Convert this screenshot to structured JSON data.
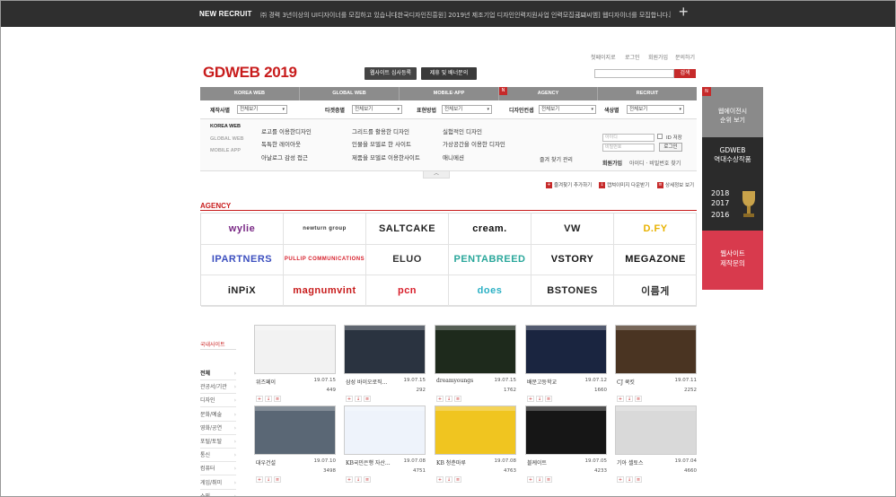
{
  "topbar": {
    "title": "NEW RECRUIT",
    "ticker": [
      "㈜ 경력 3년이상의 UI디자이너를 모집하고 있습니다.",
      "[한국디자인진흥원] 2019년 제조기업 디자인인력지원사업 인력모집공고",
      "[디씨엠] 웹디자이너를 모집합니다."
    ],
    "sep": "|"
  },
  "utility": [
    "첫페이지로",
    "로그인",
    "회원가입",
    "문의하기"
  ],
  "logo": "GDWEB 2019",
  "header_buttons": [
    "웹사이트 심사등록",
    "제휴 및 배너문의"
  ],
  "search": {
    "button": "검색"
  },
  "nav": {
    "mark": "N",
    "items": [
      "KOREA WEB",
      "GLOBAL WEB",
      "MOBILE·APP",
      "AGENCY",
      "RECRUIT"
    ]
  },
  "filters": [
    {
      "label": "제작사별",
      "value": "전체보기"
    },
    {
      "label": "타겟층별",
      "value": "전체보기"
    },
    {
      "label": "표현방법",
      "value": "전체보기"
    },
    {
      "label": "디자인컨셉",
      "value": "전체보기"
    },
    {
      "label": "색상별",
      "value": "전체보기"
    }
  ],
  "panel": {
    "tabs": [
      "KOREA WEB",
      "GLOBAL WEB",
      "MOBILE APP"
    ],
    "col1": [
      "로고를 이용한디자인",
      "독특한 레이아웃",
      "아날로그 감성 접근"
    ],
    "col2": [
      "그리드를 활용한 디자인",
      "인물을 모델로 한 사이트",
      "제품을 모델로 이용한사이트"
    ],
    "col3": [
      "실험적인 디자인",
      "가상공간을 이용한 디자인",
      "애니메션"
    ],
    "extra": "즐겨 찾기 관리",
    "login": {
      "id_placeholder": "아이디",
      "pw_placeholder": "비밀번호",
      "save_id": "ID 저장",
      "login_btn": "로그인",
      "join": "회원가입",
      "find": "아이디 · 비밀번호 찾기"
    },
    "toggle": "︿"
  },
  "quick_links": [
    "즐겨찾기 추가하기",
    "캡쳐이미지 다운받기",
    "상세정보 보기"
  ],
  "agency": {
    "title": "AGENCY",
    "logos": [
      {
        "name": "wylie",
        "color": "#7a2a86"
      },
      {
        "name": "newturn group",
        "color": "#333333"
      },
      {
        "name": "SALTCAKE",
        "color": "#222222"
      },
      {
        "name": "cream.",
        "color": "#111111"
      },
      {
        "name": "VW",
        "color": "#222222"
      },
      {
        "name": "D.FY",
        "color": "#e8b200"
      },
      {
        "name": "IPARTNERS",
        "color": "#3c4fbf"
      },
      {
        "name": "PULLIP COMMUNICATIONS",
        "color": "#d61e2a"
      },
      {
        "name": "ELUO",
        "color": "#333333"
      },
      {
        "name": "PENTABREED",
        "color": "#2aa79b"
      },
      {
        "name": "VSTORY",
        "color": "#111111"
      },
      {
        "name": "MEGAZONE",
        "color": "#111111"
      },
      {
        "name": "iNPiX",
        "color": "#222222"
      },
      {
        "name": "magnumvint",
        "color": "#c81c1c"
      },
      {
        "name": "pcn",
        "color": "#d81e2a"
      },
      {
        "name": "does",
        "color": "#2bb0c4"
      },
      {
        "name": "BSTONES",
        "color": "#222222"
      },
      {
        "name": "이름게",
        "color": "#333333"
      }
    ]
  },
  "side_banner": {
    "mark": "N",
    "top": "웹에이전시\n순위 보기",
    "mid_title": "GDWEB\n역대수상작품",
    "years": [
      "2018",
      "2017",
      "2016"
    ],
    "bottom": "웹사이트\n제작문의"
  },
  "categories": {
    "title": "국내사이트",
    "items": [
      "전체",
      "관공서/기관",
      "디자인",
      "문화/예술",
      "영화/공연",
      "포털/토탈",
      "통신",
      "컴퓨터",
      "게임/취미",
      "쇼핑"
    ]
  },
  "cards": [
    {
      "title": "위즈페이",
      "date": "19.07.15",
      "count": "449",
      "theme": "#f2f2f2"
    },
    {
      "title": "삼성 바이오로직...",
      "date": "19.07.15",
      "count": "292",
      "theme": "#2a3340"
    },
    {
      "title": "dreamyoungs",
      "date": "19.07.15",
      "count": "1762",
      "theme": "#1e2a1c"
    },
    {
      "title": "배문고등학교",
      "date": "19.07.12",
      "count": "1660",
      "theme": "#1a2540"
    },
    {
      "title": "CJ 쿡킷",
      "date": "19.07.11",
      "count": "2252",
      "theme": "#4a3422"
    },
    {
      "title": "대우건설",
      "date": "19.07.10",
      "count": "3498",
      "theme": "#5a6775"
    },
    {
      "title": "KB국민은행 자산...",
      "date": "19.07.08",
      "count": "4751",
      "theme": "#eef3fb"
    },
    {
      "title": "KB 청춘마루",
      "date": "19.07.08",
      "count": "4763",
      "theme": "#f0c520"
    },
    {
      "title": "블케이트",
      "date": "19.07.05",
      "count": "4233",
      "theme": "#161616"
    },
    {
      "title": "기아 셀토스",
      "date": "19.07.04",
      "count": "4660",
      "theme": "#d9d9d9"
    }
  ]
}
